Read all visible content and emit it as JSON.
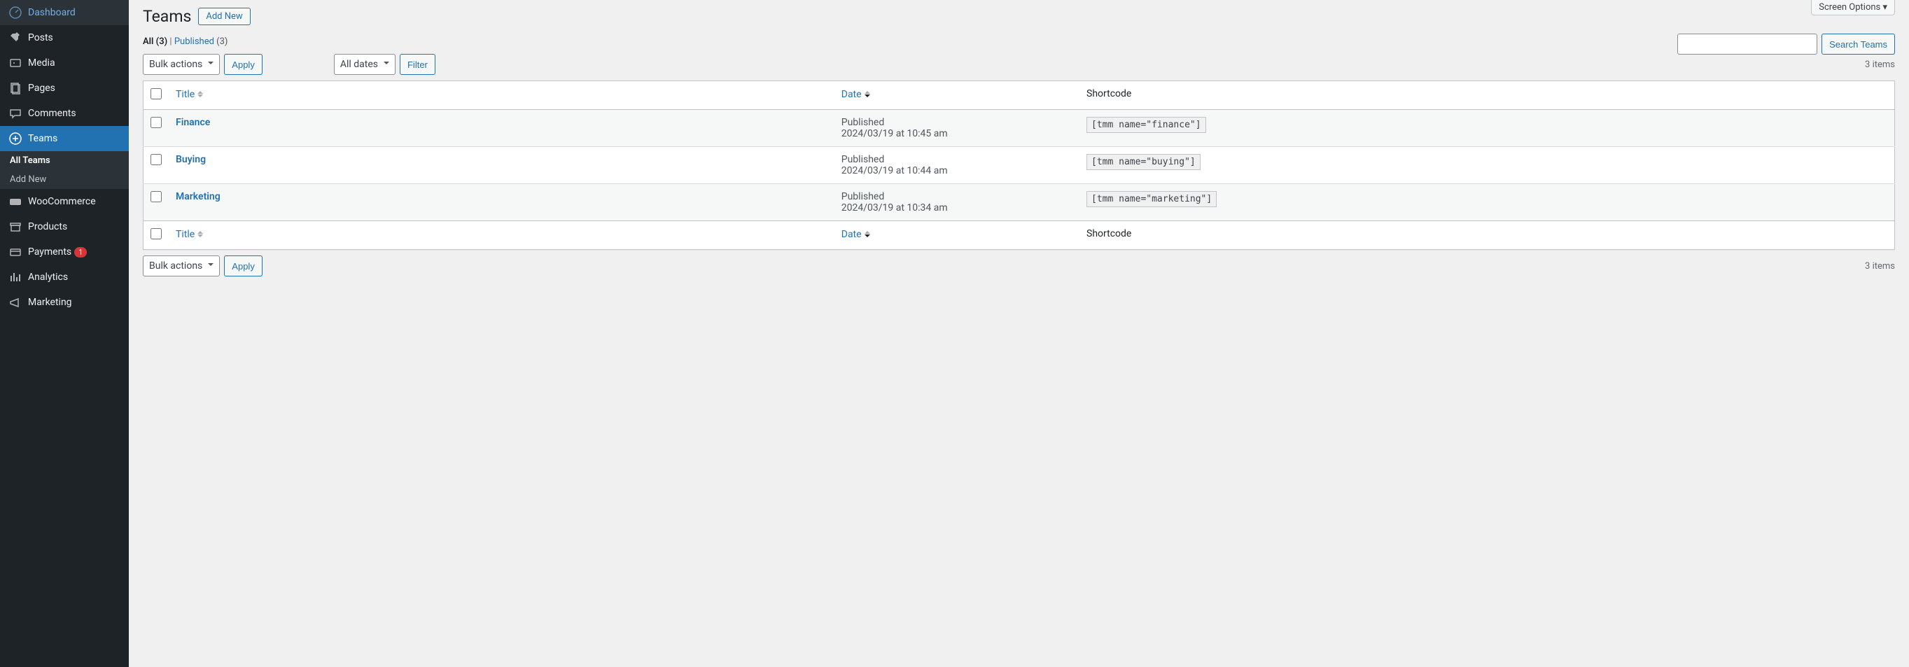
{
  "screen_options": "Screen Options ▾",
  "sidebar": {
    "items": [
      {
        "label": "Dashboard",
        "icon": "dashboard"
      },
      {
        "label": "Posts",
        "icon": "pin"
      },
      {
        "label": "Media",
        "icon": "media"
      },
      {
        "label": "Pages",
        "icon": "page"
      },
      {
        "label": "Comments",
        "icon": "comment"
      },
      {
        "label": "Teams",
        "icon": "plus",
        "active": true
      },
      {
        "label": "WooCommerce",
        "icon": "woo"
      },
      {
        "label": "Products",
        "icon": "archive"
      },
      {
        "label": "Payments",
        "icon": "card",
        "badge": "1"
      },
      {
        "label": "Analytics",
        "icon": "chart"
      },
      {
        "label": "Marketing",
        "icon": "megaphone"
      }
    ],
    "submenu": [
      {
        "label": "All Teams",
        "current": true
      },
      {
        "label": "Add New"
      }
    ]
  },
  "header": {
    "title": "Teams",
    "add_new": "Add New"
  },
  "filters": {
    "all_label": "All",
    "all_count": "(3)",
    "published_label": "Published",
    "published_count": "(3)",
    "separator": " | "
  },
  "search": {
    "button": "Search Teams",
    "value": ""
  },
  "bulk": {
    "select_label": "Bulk actions",
    "apply": "Apply",
    "date_select": "All dates",
    "filter": "Filter"
  },
  "pagination": {
    "items_text": "3 items"
  },
  "table": {
    "columns": {
      "title": "Title",
      "date": "Date",
      "shortcode": "Shortcode"
    },
    "rows": [
      {
        "title": "Finance",
        "status": "Published",
        "datetime": "2024/03/19 at 10:45 am",
        "shortcode": "[tmm name=\"finance\"]"
      },
      {
        "title": "Buying",
        "status": "Published",
        "datetime": "2024/03/19 at 10:44 am",
        "shortcode": "[tmm name=\"buying\"]"
      },
      {
        "title": "Marketing",
        "status": "Published",
        "datetime": "2024/03/19 at 10:34 am",
        "shortcode": "[tmm name=\"marketing\"]"
      }
    ]
  }
}
